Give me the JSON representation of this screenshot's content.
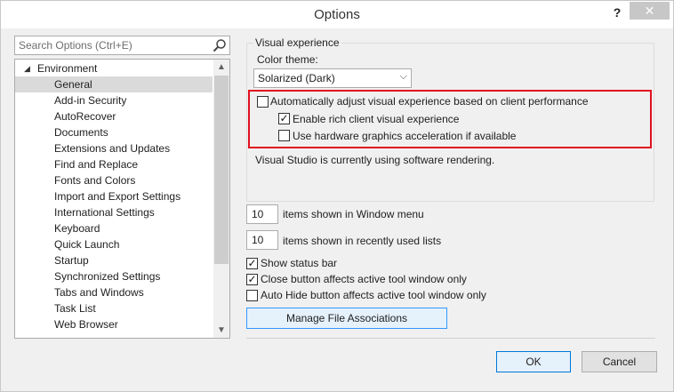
{
  "window": {
    "title": "Options",
    "help": "?",
    "close": "✕"
  },
  "search": {
    "placeholder": "Search Options (Ctrl+E)"
  },
  "tree": {
    "root": "Environment",
    "items": [
      "General",
      "Add-in Security",
      "AutoRecover",
      "Documents",
      "Extensions and Updates",
      "Find and Replace",
      "Fonts and Colors",
      "Import and Export Settings",
      "International Settings",
      "Keyboard",
      "Quick Launch",
      "Startup",
      "Synchronized Settings",
      "Tabs and Windows",
      "Task List",
      "Web Browser"
    ],
    "selected": "General"
  },
  "visual_experience": {
    "legend": "Visual experience",
    "color_theme_label": "Color theme:",
    "color_theme_value": "Solarized (Dark)",
    "auto_adjust_label": "Automatically adjust visual experience based on client performance",
    "auto_adjust_checked": false,
    "rich_client_label": "Enable rich client visual experience",
    "rich_client_checked": true,
    "hw_accel_label": "Use hardware graphics acceleration if available",
    "hw_accel_checked": false,
    "status_text": "Visual Studio is currently using software rendering."
  },
  "window_menu": {
    "value": "10",
    "label": "items shown in Window menu"
  },
  "recent_lists": {
    "value": "10",
    "label": "items shown in recently used lists"
  },
  "status_bar": {
    "label": "Show status bar",
    "checked": true
  },
  "close_button": {
    "label": "Close button affects active tool window only",
    "checked": true
  },
  "auto_hide": {
    "label": "Auto Hide button affects active tool window only",
    "checked": false
  },
  "manage_file_assoc": "Manage File Associations",
  "footer": {
    "ok": "OK",
    "cancel": "Cancel"
  },
  "colors": {
    "highlight": "#e01020",
    "selected": "#dadada",
    "accent": "#0078d7"
  }
}
